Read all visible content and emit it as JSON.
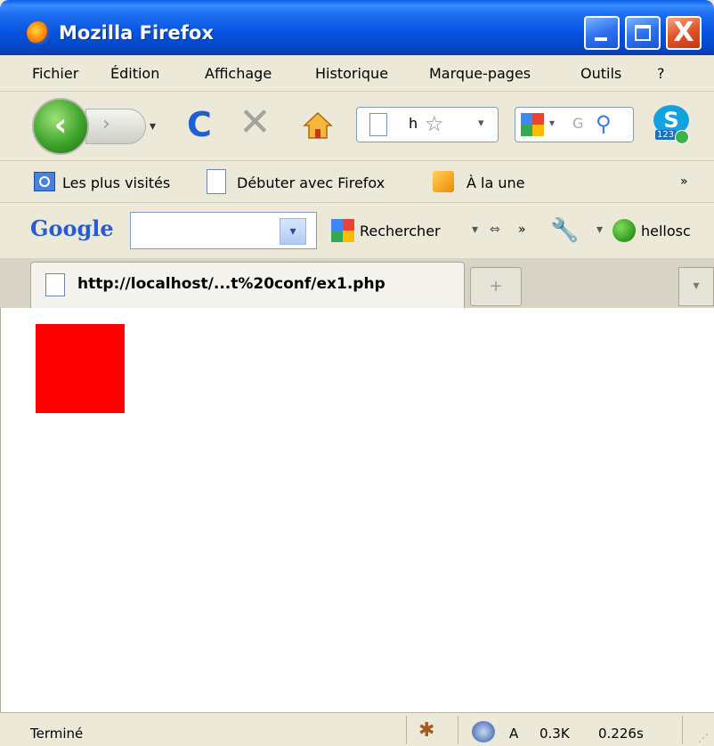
{
  "window": {
    "title": "Mozilla Firefox",
    "close_glyph": "X"
  },
  "menubar": {
    "items": [
      "Fichier",
      "Édition",
      "Affichage",
      "Historique",
      "Marque-pages",
      "Outils",
      "?"
    ]
  },
  "navbar": {
    "url_value": "h",
    "search_placeholder": "G"
  },
  "bookmarks": {
    "items": [
      "Les plus visités",
      "Débuter avec Firefox",
      "À la une"
    ],
    "more": "»"
  },
  "google_toolbar": {
    "logo": "Google",
    "search_label": "Rechercher",
    "more": "»",
    "user": "hellosc"
  },
  "tabs": [
    {
      "title": "http://localhost/...t%20conf/ex1.php",
      "active": true
    }
  ],
  "content": {
    "box_color": "#ff0000"
  },
  "statusbar": {
    "status": "Terminé",
    "indicator": "A",
    "size": "0.3K",
    "time": "0.226s"
  }
}
